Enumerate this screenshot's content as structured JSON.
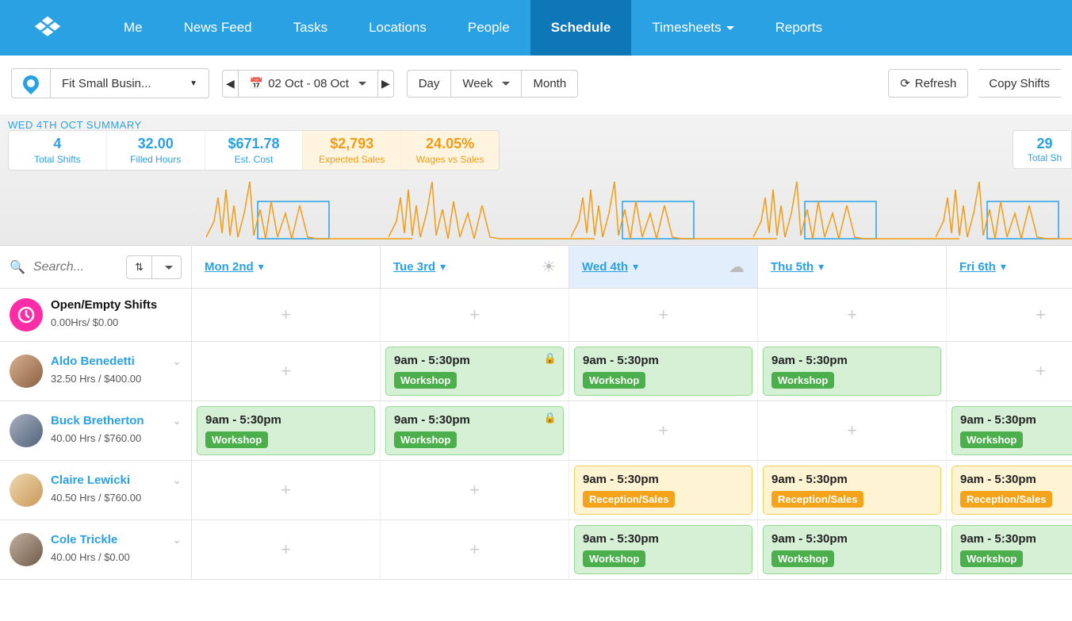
{
  "nav": {
    "items": [
      "Me",
      "News Feed",
      "Tasks",
      "Locations",
      "People",
      "Schedule",
      "Timesheets",
      "Reports"
    ],
    "active": "Schedule",
    "dropdown": [
      "Timesheets"
    ]
  },
  "toolbar": {
    "location": "Fit Small Busin...",
    "date_range": "02 Oct - 08 Oct",
    "views": {
      "day": "Day",
      "week": "Week",
      "month": "Month"
    },
    "refresh": "Refresh",
    "copy": "Copy Shifts"
  },
  "summary": {
    "title": "WED 4TH OCT SUMMARY",
    "boxes": [
      {
        "val": "4",
        "lbl": "Total Shifts",
        "style": "blue"
      },
      {
        "val": "32.00",
        "lbl": "Filled Hours",
        "style": "blue"
      },
      {
        "val": "$671.78",
        "lbl": "Est. Cost",
        "style": "blue"
      },
      {
        "val": "$2,793",
        "lbl": "Expected Sales",
        "style": "orange"
      },
      {
        "val": "24.05%",
        "lbl": "Wages vs Sales",
        "style": "orange"
      }
    ],
    "right": {
      "val": "29",
      "lbl": "Total Sh"
    }
  },
  "header_days": [
    {
      "label": "Mon 2nd",
      "weather": null,
      "active": false
    },
    {
      "label": "Tue 3rd",
      "weather": "sun",
      "active": false
    },
    {
      "label": "Wed 4th",
      "weather": "cloud",
      "active": true
    },
    {
      "label": "Thu 5th",
      "weather": null,
      "active": false
    },
    {
      "label": "Fri 6th",
      "weather": null,
      "active": false
    }
  ],
  "search_placeholder": "Search...",
  "employees": [
    {
      "name": "Open/Empty Shifts",
      "sub": "0.00Hrs/ $0.00",
      "open": true,
      "shifts": [
        null,
        null,
        null,
        null,
        null
      ]
    },
    {
      "name": "Aldo Benedetti",
      "sub": "32.50 Hrs / $400.00",
      "avatar": "av1",
      "shifts": [
        null,
        {
          "time": "9am - 5:30pm",
          "tag": "Workshop",
          "color": "green",
          "locked": true
        },
        {
          "time": "9am - 5:30pm",
          "tag": "Workshop",
          "color": "green"
        },
        {
          "time": "9am - 5:30pm",
          "tag": "Workshop",
          "color": "green"
        },
        null
      ]
    },
    {
      "name": "Buck Bretherton",
      "sub": "40.00 Hrs / $760.00",
      "avatar": "av2",
      "shifts": [
        {
          "time": "9am - 5:30pm",
          "tag": "Workshop",
          "color": "green"
        },
        {
          "time": "9am - 5:30pm",
          "tag": "Workshop",
          "color": "green",
          "locked": true
        },
        null,
        null,
        {
          "time": "9am - 5:30pm",
          "tag": "Workshop",
          "color": "green"
        }
      ]
    },
    {
      "name": "Claire Lewicki",
      "sub": "40.50 Hrs / $760.00",
      "avatar": "av3",
      "shifts": [
        null,
        null,
        {
          "time": "9am - 5:30pm",
          "tag": "Reception/Sales",
          "color": "yellow"
        },
        {
          "time": "9am - 5:30pm",
          "tag": "Reception/Sales",
          "color": "yellow"
        },
        {
          "time": "9am - 5:30pm",
          "tag": "Reception/Sales",
          "color": "yellow"
        }
      ]
    },
    {
      "name": "Cole Trickle",
      "sub": "40.00 Hrs / $0.00",
      "avatar": "av4",
      "shifts": [
        null,
        null,
        {
          "time": "9am - 5:30pm",
          "tag": "Workshop",
          "color": "green"
        },
        {
          "time": "9am - 5:30pm",
          "tag": "Workshop",
          "color": "green"
        },
        {
          "time": "9am - 5:30pm",
          "tag": "Workshop",
          "color": "green"
        }
      ]
    }
  ]
}
